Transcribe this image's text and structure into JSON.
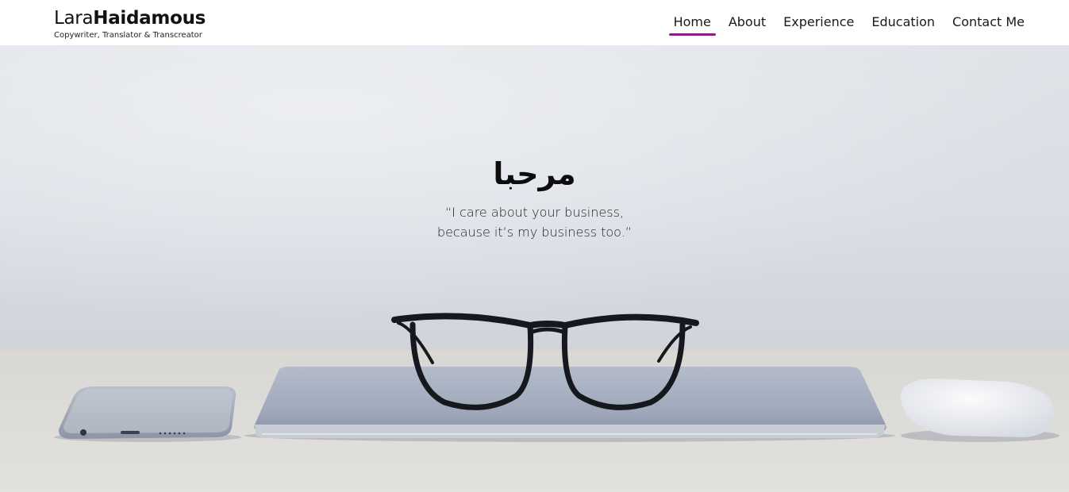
{
  "header": {
    "logo_first": "Lara",
    "logo_last": "Haidamous",
    "tagline": "Copywriter, Translator & Transcreator"
  },
  "nav": {
    "items": [
      {
        "label": "Home",
        "active": true
      },
      {
        "label": "About",
        "active": false
      },
      {
        "label": "Experience",
        "active": false
      },
      {
        "label": "Education",
        "active": false
      },
      {
        "label": "Contact Me",
        "active": false
      }
    ]
  },
  "hero": {
    "title": "مرحبا",
    "quote_line1": "“I care about your business,",
    "quote_line2": "because it’s my business too.”",
    "background_image": "glasses-on-laptop-desk-photo"
  },
  "colors": {
    "accent": "#8a1f86",
    "header_bg": "#ffffff",
    "text": "#111111"
  }
}
